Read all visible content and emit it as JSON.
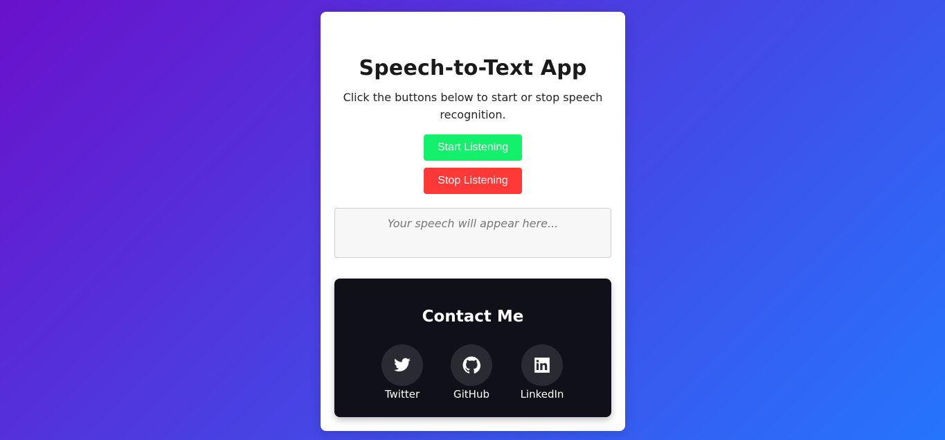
{
  "app": {
    "title": "Speech-to-Text App",
    "description": "Click the buttons below to start or stop speech recognition."
  },
  "controls": {
    "start_label": "Start Listening",
    "stop_label": "Stop Listening"
  },
  "output": {
    "placeholder": "Your speech will appear here..."
  },
  "contact": {
    "title": "Contact Me",
    "links": [
      {
        "label": "Twitter",
        "icon": "twitter-icon"
      },
      {
        "label": "GitHub",
        "icon": "github-icon"
      },
      {
        "label": "LinkedIn",
        "icon": "linkedin-icon"
      }
    ]
  },
  "colors": {
    "start": "#13f06c",
    "stop": "#ff3838",
    "contact_bg": "#101018",
    "gradient_start": "#6a11cb",
    "gradient_end": "#2575fc"
  }
}
